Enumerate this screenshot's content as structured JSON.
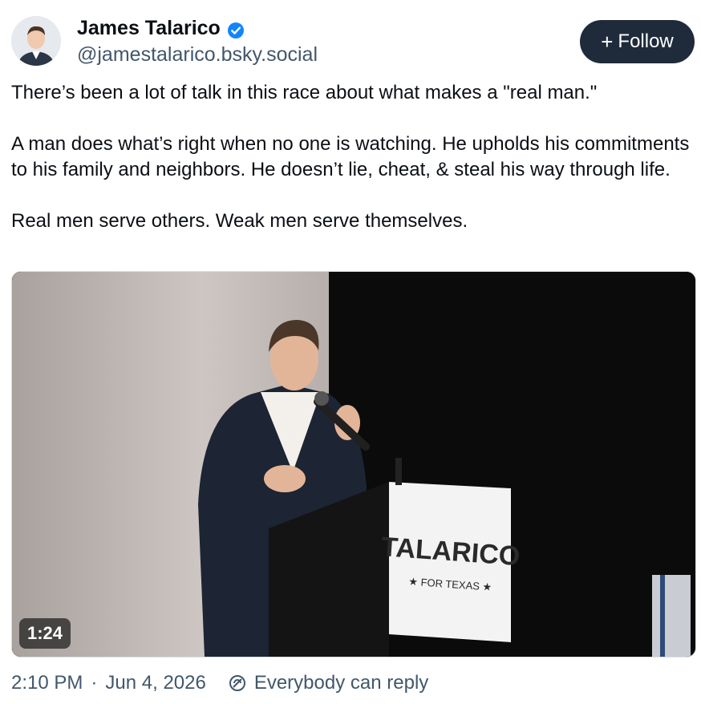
{
  "author": {
    "name": "James Talarico",
    "handle": "@jamestalarico.bsky.social"
  },
  "follow_button": {
    "label": "Follow",
    "icon": "plus-icon"
  },
  "post": {
    "paragraphs": [
      "There’s been a lot of talk in this race about what makes a \"real man.\"",
      "A man does what’s right when no one is watching. He upholds his commitments to his family and neighbors. He doesn’t lie, cheat, & steal his way through life.",
      "Real men serve others. Weak men serve themselves."
    ]
  },
  "video": {
    "duration": "1:24",
    "podium_sign": {
      "name": "TALARICO",
      "subtitle": "★ FOR TEXAS ★"
    }
  },
  "meta": {
    "time": "2:10 PM",
    "separator": "·",
    "date": "Jun 4, 2026",
    "reply_setting": "Everybody can reply"
  },
  "colors": {
    "accent": "#1f2b3a",
    "verified": "#1185fe",
    "muted": "#42576c"
  }
}
